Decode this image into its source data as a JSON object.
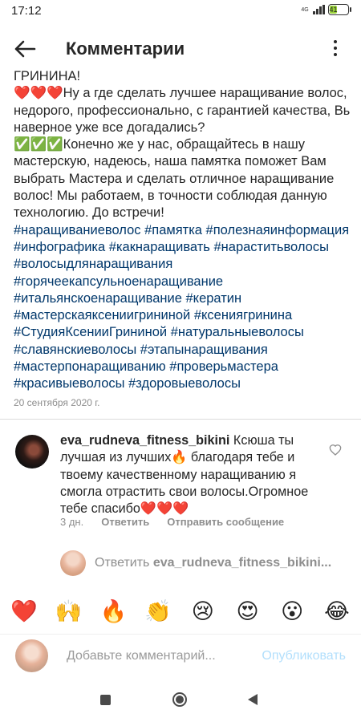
{
  "status_bar": {
    "time": "17:12",
    "network": "4G",
    "battery": "41",
    "battery_level": 0.41
  },
  "header": {
    "title": "Комментарии"
  },
  "caption": {
    "lines": [
      "ГРИНИНА!",
      "❤️❤️❤️Ну а где сделать лучшее наращивание волос,",
      "недорого, профессионально, с гарантией качества, Вы",
      "наверное уже все догадались?",
      "✅✅✅Конечно же у нас, обращайтесь в нашу",
      "мастерскую, надеюсь, наша памятка поможет Вам",
      "выбрать Мастера и сделать отличное наращивание",
      "волос! Мы работаем, в точности соблюдая данную",
      "технологию. До встречи!"
    ],
    "hashtag_lines": [
      "#наращиваниеволос #памятка #полезнаяинформация",
      "#инфографика #какнаращивать #нараститьволосы",
      "#волосыдлянаращивания",
      "#горячеекапсульноенаращивание",
      "#итальянскоенаращивание #кератин",
      "#мастерскаяксениигрининой #ксениягринина",
      "#СтудияКсенииГрининой #натуральныеволосы",
      "#славянскиеволосы #этапынаращивания",
      "#мастерпонаращиванию #проверьмастера",
      "#красивыеволосы #здоровыеволосы"
    ],
    "date": "20 сентября 2020 г."
  },
  "comment": {
    "username": "eva_rudneva_fitness_bikini",
    "lines": [
      " Ксюша ты",
      "лучшая из лучших🔥 благодаря тебе и",
      "твоему качественному наращиванию я",
      "смогла отрастить свои волосы.Огромное",
      "тебе спасибо❤️❤️❤️"
    ],
    "time": "3 дн.",
    "reply_label": "Ответить",
    "send_label": "Отправить сообщение"
  },
  "reply_box": {
    "prefix": "Ответить ",
    "username": "eva_rudneva_fitness_bikini..."
  },
  "emoji_bar": [
    "❤️",
    "🙌",
    "🔥",
    "👏",
    "😢",
    "😍",
    "😮",
    "😂"
  ],
  "add_comment": {
    "placeholder": "Добавьте комментарий...",
    "publish_label": "Опубликовать"
  },
  "colors": {
    "hashtag": "#00376b",
    "secondary_text": "#8e8e8e",
    "publish_disabled": "#b2dffc"
  }
}
